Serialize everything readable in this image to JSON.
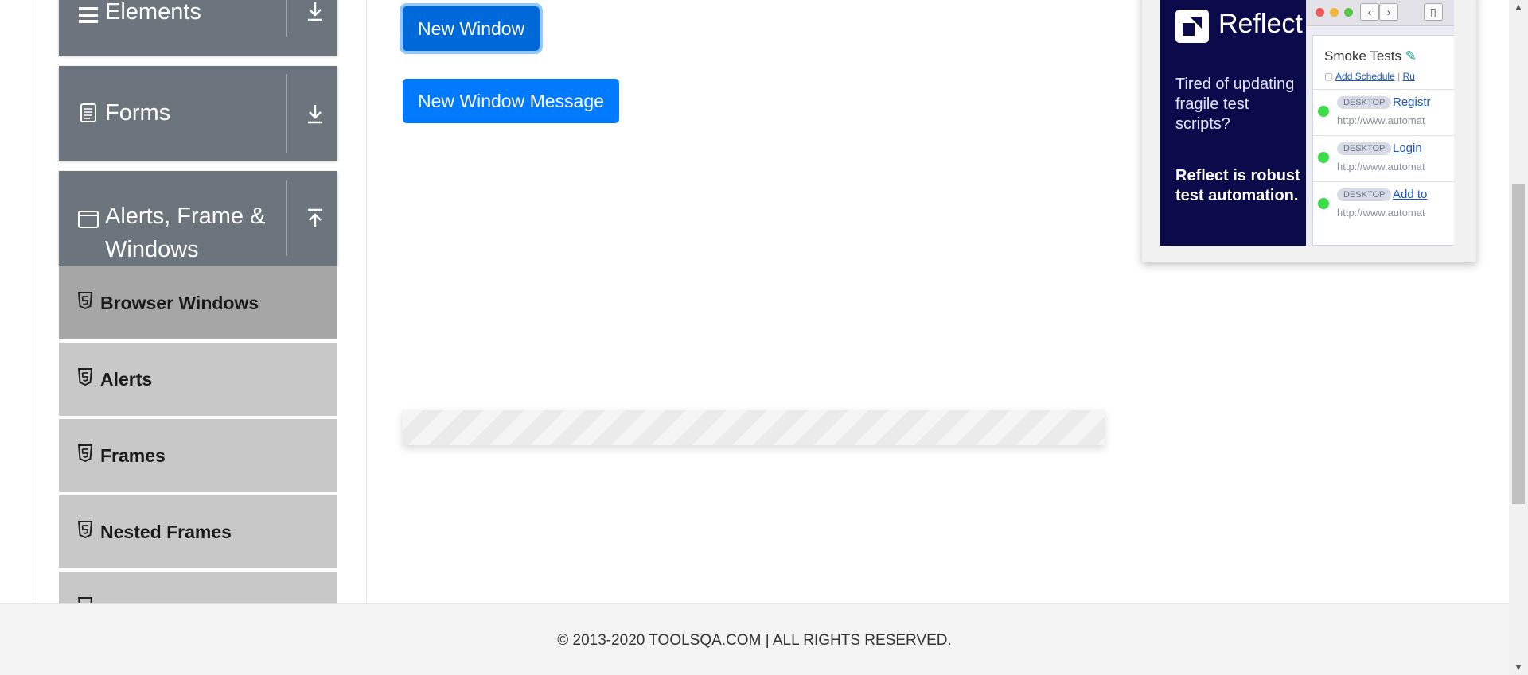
{
  "sidebar": {
    "groups": [
      {
        "label": "Elements",
        "icon": "hamburger-icon",
        "arrow": "download-arrow-icon"
      },
      {
        "label": "Forms",
        "icon": "document-icon",
        "arrow": "download-arrow-icon"
      },
      {
        "label": "Alerts, Frame & Windows",
        "icon": "window-icon",
        "arrow": "upload-arrow-icon"
      }
    ],
    "items": [
      {
        "label": "Browser Windows",
        "icon": "html5-icon",
        "active": true
      },
      {
        "label": "Alerts",
        "icon": "html5-icon"
      },
      {
        "label": "Frames",
        "icon": "html5-icon"
      },
      {
        "label": "Nested Frames",
        "icon": "html5-icon"
      }
    ]
  },
  "main": {
    "new_window_label": "New Window",
    "new_window_message_label": "New Window Message"
  },
  "ad": {
    "brand": "Reflect",
    "question": "Tired of updating fragile test scripts?",
    "tagline": "Reflect is robust test automation.",
    "panel_title": "Smoke Tests",
    "add_schedule": "Add Schedule",
    "run_link": "Ru",
    "rows": [
      {
        "badge": "DESKTOP",
        "link": "Registr",
        "url": "http://www.automat"
      },
      {
        "badge": "DESKTOP",
        "link": "Login",
        "url": "http://www.automat"
      },
      {
        "badge": "DESKTOP",
        "link": "Add to",
        "url": "http://www.automat"
      }
    ]
  },
  "footer": {
    "text": "© 2013-2020 TOOLSQA.COM | ALL RIGHTS RESERVED."
  },
  "colors": {
    "primary": "#007bff",
    "sidebar_header": "#6c757d",
    "sidebar_item": "#c8c8c8",
    "sidebar_item_active": "#a6a6a6",
    "ad_bg": "#0b0a4a"
  }
}
